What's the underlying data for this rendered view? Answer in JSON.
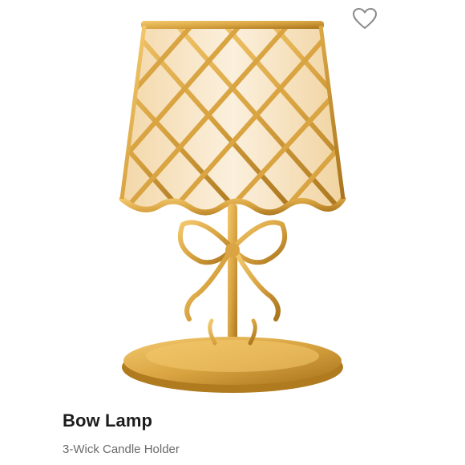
{
  "product": {
    "name": "Bow Lamp",
    "subtitle": "3-Wick Candle Holder"
  },
  "icons": {
    "favorite": "heart-outline-icon"
  },
  "colors": {
    "gold": "#d9a441",
    "gold_dark": "#b07a1e",
    "shade_glow": "#f8e7c8",
    "title": "#1c1c1c",
    "subtitle": "#6a6a6a"
  }
}
